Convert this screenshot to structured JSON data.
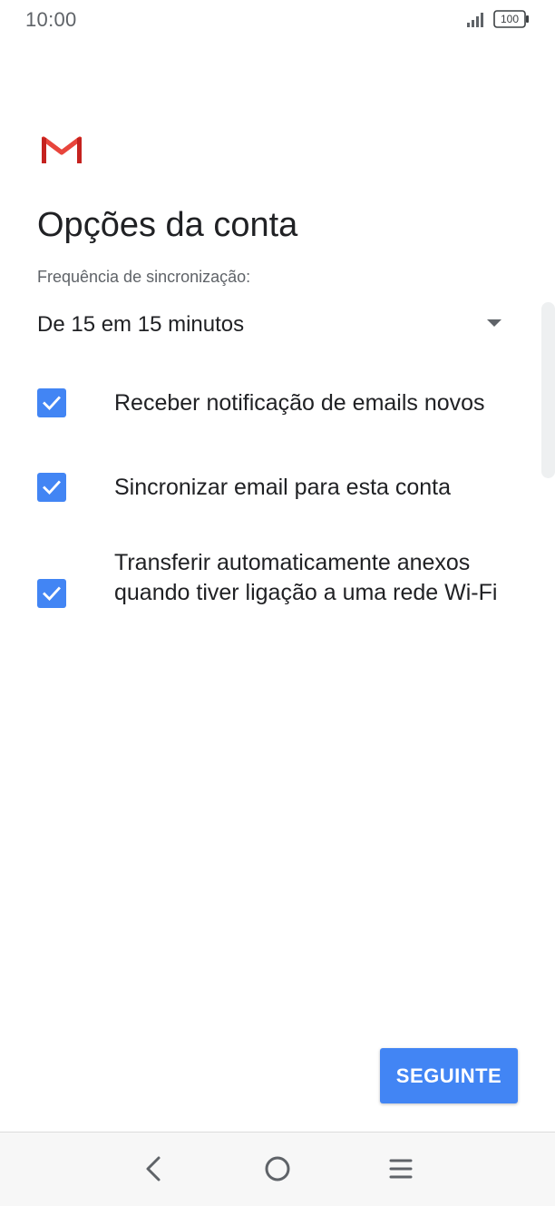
{
  "status_bar": {
    "time": "10:00",
    "battery": "100"
  },
  "header": {
    "logo_icon": "gmail-logo-icon",
    "title": "Opções da conta"
  },
  "sync": {
    "label": "Frequência de sincronização:",
    "selected_value": "De 15 em 15 minutos"
  },
  "options": [
    {
      "label": "Receber notificação de emails novos",
      "checked": true
    },
    {
      "label": "Sincronizar email para esta conta",
      "checked": true
    },
    {
      "label": "Transferir automaticamente anexos quando tiver ligação a uma rede Wi-Fi",
      "checked": true
    }
  ],
  "footer": {
    "next_label": "SEGUINTE"
  },
  "nav_bar": {
    "back_icon": "back-icon",
    "home_icon": "home-icon",
    "menu_icon": "menu-icon"
  },
  "colors": {
    "accent": "#4285f4",
    "gmail_red": "#d93025",
    "text_primary": "#202124",
    "text_secondary": "#5f6368"
  }
}
